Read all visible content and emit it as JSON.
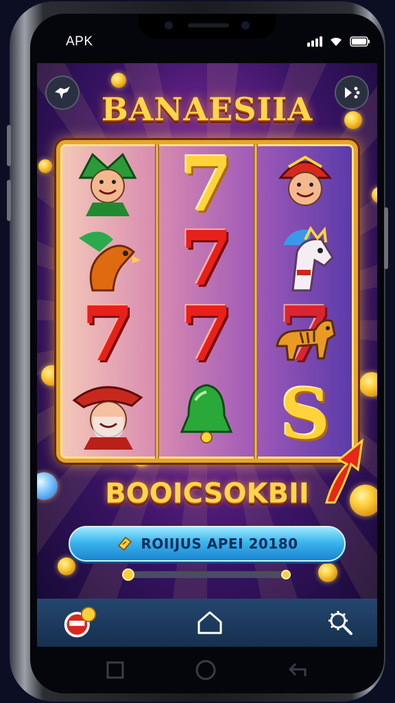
{
  "status_bar": {
    "carrier": "APK"
  },
  "game": {
    "title": "BANAESIIA",
    "subtitle": "BOOICSOKBII",
    "bonus_button": {
      "label": "ROIIJUS APEI 20180",
      "icon": "ticket-icon"
    },
    "progress": {
      "value": 0.05
    },
    "reels": [
      [
        "jester",
        "rooster",
        "7",
        "old-man-hat"
      ],
      [
        "7",
        "7",
        "7",
        "bell"
      ],
      [
        "jester",
        "horse",
        "7-tiger",
        "S"
      ]
    ],
    "symbol_text": {
      "seven": "7",
      "s": "S"
    }
  },
  "top_buttons": {
    "left_icon": "bird-icon",
    "right_icon": "share-icon"
  },
  "bottom_nav": {
    "left_icon": "shield-coin-icon",
    "center_icon": "home-icon",
    "right_icon": "settings-search-icon"
  },
  "system_nav": [
    "recents-icon",
    "home-circle-icon",
    "back-icon"
  ],
  "colors": {
    "gold": "#ffd64a",
    "red": "#e8201a",
    "bonus_blue": "#3bb6ee",
    "nav_bg": "#1e3d63"
  }
}
